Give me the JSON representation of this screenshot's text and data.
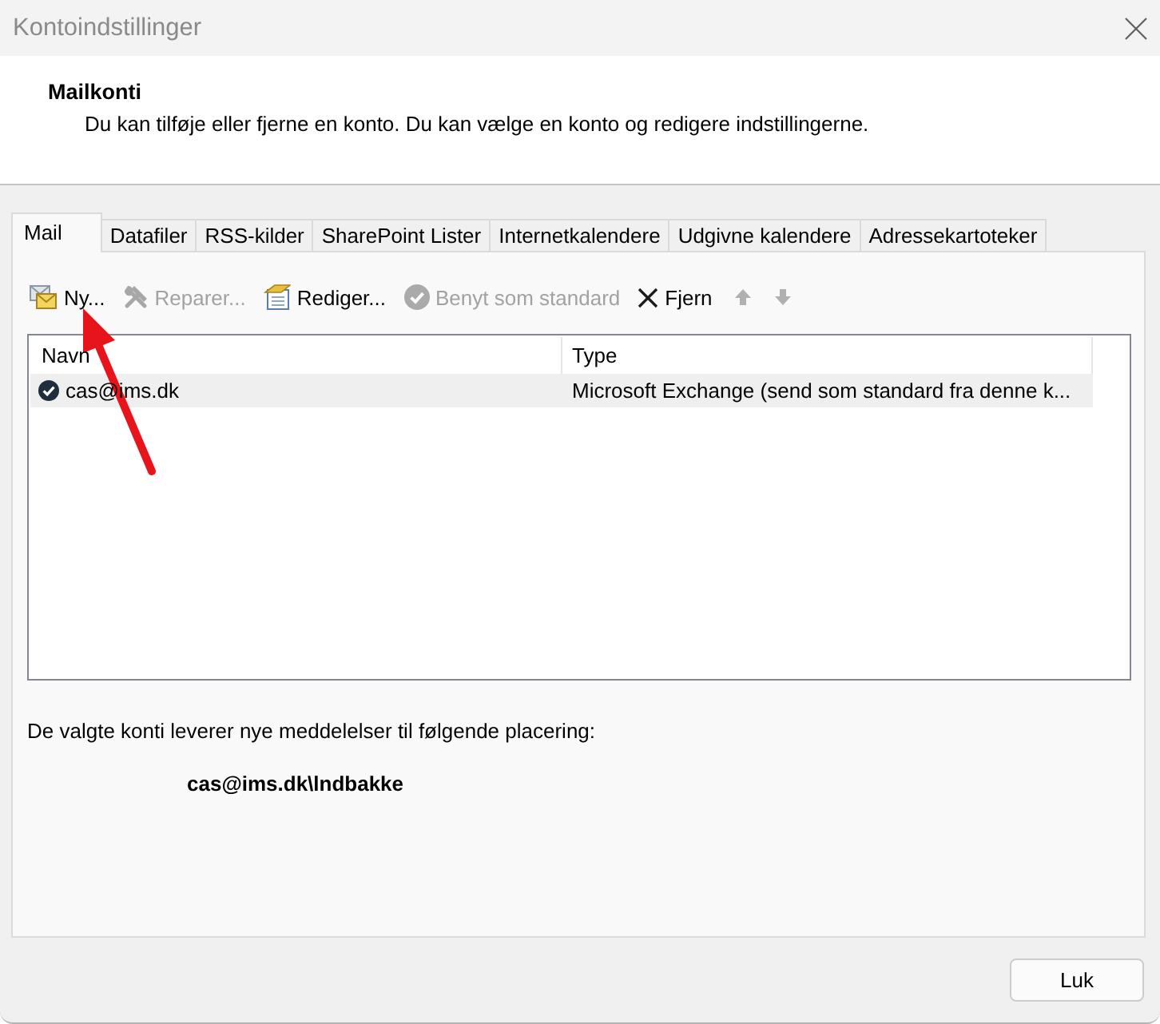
{
  "window": {
    "title": "Kontoindstillinger"
  },
  "header": {
    "title": "Mailkonti",
    "description": "Du kan tilføje eller fjerne en konto. Du kan vælge en konto og redigere indstillingerne."
  },
  "tabs": [
    {
      "label": "Mail",
      "selected": true
    },
    {
      "label": "Datafiler",
      "selected": false
    },
    {
      "label": "RSS-kilder",
      "selected": false
    },
    {
      "label": "SharePoint Lister",
      "selected": false
    },
    {
      "label": "Internetkalendere",
      "selected": false
    },
    {
      "label": "Udgivne kalendere",
      "selected": false
    },
    {
      "label": "Adressekartoteker",
      "selected": false
    }
  ],
  "toolbar": [
    {
      "kind": "new",
      "label": "Ny...",
      "disabled": false
    },
    {
      "kind": "repair",
      "label": "Reparer...",
      "disabled": true
    },
    {
      "kind": "edit",
      "label": "Rediger...",
      "disabled": false
    },
    {
      "kind": "default",
      "label": "Benyt som standard",
      "disabled": true
    },
    {
      "kind": "remove",
      "label": "Fjern",
      "disabled": false
    },
    {
      "kind": "up",
      "disabled": true
    },
    {
      "kind": "down",
      "disabled": true
    }
  ],
  "account_list": {
    "columns": [
      "Navn",
      "Type"
    ],
    "rows": [
      {
        "cells": [
          "cas@ims.dk",
          "Microsoft Exchange (send som standard fra denne k..."
        ],
        "default": true,
        "selected": true
      }
    ]
  },
  "delivery": {
    "label": "De valgte konti leverer nye meddelelser til følgende placering:",
    "location": "cas@ims.dk\\lndbakke"
  },
  "buttons": [
    "Luk"
  ],
  "annotations": [
    {
      "kind": "arrow"
    }
  ]
}
